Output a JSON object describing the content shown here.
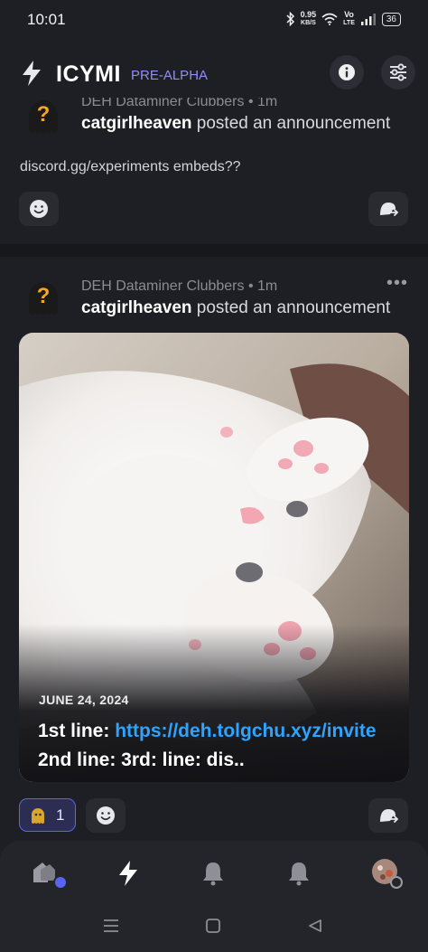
{
  "status": {
    "time": "10:01",
    "net_speed_value": "0.95",
    "net_speed_unit": "KB/S",
    "network_label_1": "Vo",
    "network_label_2": "LTE",
    "battery": "36"
  },
  "header": {
    "title": "ICYMI",
    "badge": "PRE-ALPHA",
    "icons": [
      "bolt-icon",
      "info-icon",
      "filter-sliders-icon"
    ]
  },
  "posts": [
    {
      "server": "DEH Dataminer Clubbers",
      "age": "1m",
      "author": "catgirlheaven",
      "action": "posted an announcement",
      "text": "discord.gg/experiments embeds??"
    },
    {
      "server": "DEH Dataminer Clubbers",
      "age": "1m",
      "author": "catgirlheaven",
      "action": "posted an announcement",
      "embed": {
        "date": "JUNE 24, 2024",
        "title_prefix": "1st line: ",
        "title_link": "https://deh.tolgchu.xyz/invite",
        "title_suffix": " 2nd line: 3rd: line: dis.."
      },
      "reaction": {
        "count": "1"
      }
    }
  ],
  "separators": {
    "meta_dot": " • "
  },
  "nav": {
    "items": [
      "servers-icon",
      "highlights-bolt-icon",
      "notifications-bell-icon",
      "mentions-bell-icon",
      "profile-avatar"
    ]
  },
  "colors": {
    "background": "#1e1f24",
    "accent": "#8f8ff5",
    "link": "#2fa4ff",
    "reaction_border": "#5865f2"
  }
}
